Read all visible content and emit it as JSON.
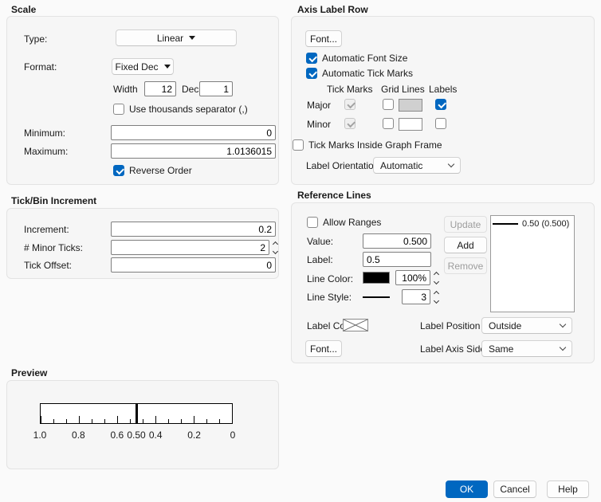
{
  "colors": {
    "accent": "#0067c0"
  },
  "scale": {
    "title": "Scale",
    "type_label": "Type:",
    "type_value": "Linear",
    "format_label": "Format:",
    "format_value": "Fixed Dec",
    "width_label": "Width",
    "width_value": "12",
    "dec_label": "Dec",
    "dec_value": "1",
    "thousands_label": "Use thousands separator (,)",
    "minimum_label": "Minimum:",
    "minimum_value": "0",
    "maximum_label": "Maximum:",
    "maximum_value": "1.0136015",
    "reverse_label": "Reverse Order"
  },
  "tick_bin": {
    "title": "Tick/Bin Increment",
    "increment_label": "Increment:",
    "increment_value": "0.2",
    "minor_label": "# Minor Ticks:",
    "minor_value": "2",
    "offset_label": "Tick Offset:",
    "offset_value": "0"
  },
  "axis_label_row": {
    "title": "Axis Label Row",
    "font_button": "Font...",
    "auto_font": "Automatic Font Size",
    "auto_ticks": "Automatic Tick Marks",
    "col_ticks": "Tick Marks",
    "col_grid": "Grid Lines",
    "col_labels": "Labels",
    "major": "Major",
    "minor": "Minor",
    "inside_frame": "Tick Marks Inside Graph Frame",
    "orientation_label": "Label Orientation:",
    "orientation_value": "Automatic"
  },
  "reference_lines": {
    "title": "Reference Lines",
    "allow_ranges": "Allow Ranges",
    "value_label": "Value:",
    "value_value": "0.500",
    "label_label": "Label:",
    "label_value": "0.5",
    "line_color_label": "Line Color:",
    "opacity_value": "100%",
    "line_style_label": "Line Style:",
    "width_value": "3",
    "update": "Update",
    "add": "Add",
    "remove": "Remove",
    "list_item": "0.50 (0.500)",
    "label_color": "Label Color",
    "font_button": "Font...",
    "position_label": "Label Position",
    "position_value": "Outside",
    "side_label": "Label Axis Side",
    "side_value": "Same"
  },
  "preview": {
    "title": "Preview",
    "tick_labels": [
      "1.0",
      "0.8",
      "0.6",
      "0.4",
      "0.2",
      "0"
    ],
    "ref_label": "0.50"
  },
  "footer": {
    "ok": "OK",
    "cancel": "Cancel",
    "help": "Help"
  }
}
